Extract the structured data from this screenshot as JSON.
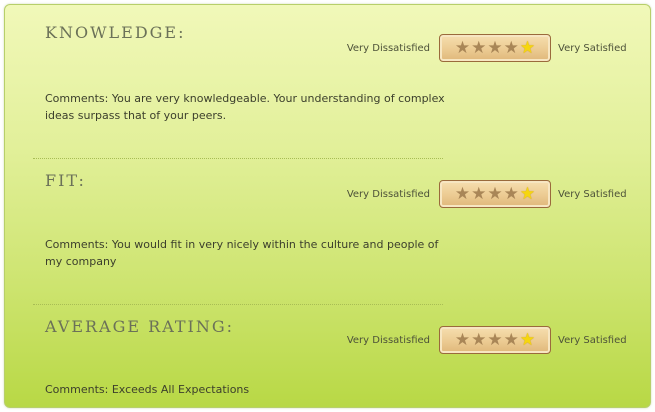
{
  "sections": [
    {
      "heading": "KNOWLEDGE:",
      "rating": {
        "left_label": "Very Dissatisfied",
        "right_label": "Very Satisfied",
        "max": 5,
        "selected_star": 5
      },
      "comment": "Comments: You are very knowledgeable. Your understanding of complex ideas surpass that of your peers."
    },
    {
      "heading": "FIT:",
      "rating": {
        "left_label": "Very Dissatisfied",
        "right_label": "Very Satisfied",
        "max": 5,
        "selected_star": 5
      },
      "comment": "Comments: You would fit in very nicely within the culture and people of my company"
    },
    {
      "heading": "AVERAGE RATING:",
      "rating": {
        "left_label": "Very Dissatisfied",
        "right_label": "Very Satisfied",
        "max": 5,
        "selected_star": 5
      },
      "comment": "Comments: Exceeds All Expectations"
    }
  ],
  "icons": {
    "star": "star-icon"
  },
  "colors": {
    "selected_star": "#f6d60e",
    "unselected_star": "#a98657",
    "panel": "#d8ec86"
  }
}
